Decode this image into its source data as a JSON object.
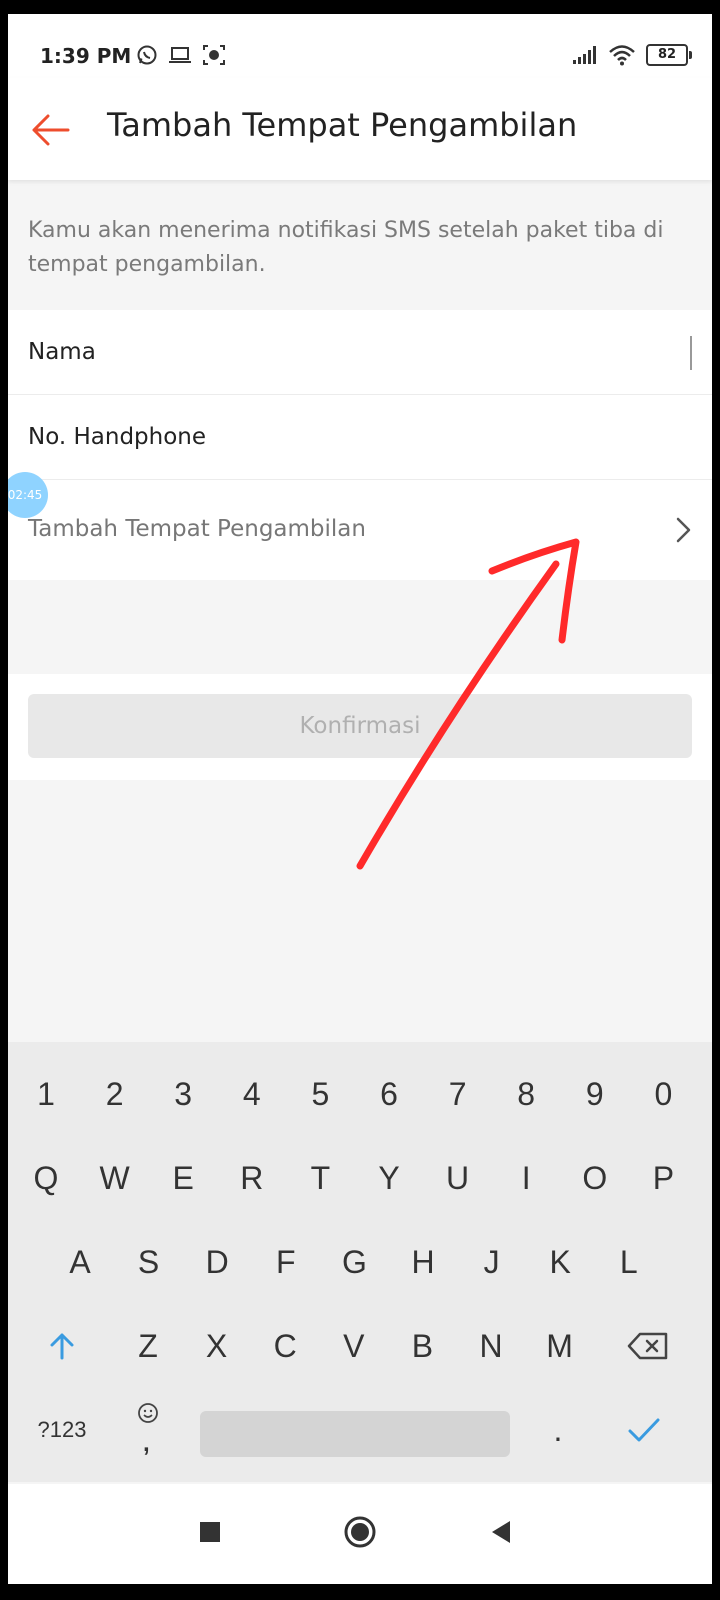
{
  "status_bar": {
    "time": "1:39 PM",
    "battery": "82",
    "icons_left": [
      "whatsapp-icon",
      "laptop-icon",
      "screen-record-icon"
    ],
    "icons_right": [
      "signal-icon",
      "wifi-icon",
      "battery-icon"
    ]
  },
  "header": {
    "title": "Tambah Tempat Pengambilan",
    "back_icon": "arrow-left-icon",
    "accent_color": "#ee4d2d"
  },
  "notice": "Kamu akan menerima notifikasi SMS setelah paket tiba di tempat pengambilan.",
  "form": {
    "name_label": "Nama",
    "phone_label": "No. Handphone",
    "pickup_label": "Tambah Tempat Pengambilan"
  },
  "floating_bubble": "02:45",
  "confirm_label": "Konfirmasi",
  "keyboard": {
    "numbers": [
      "1",
      "2",
      "3",
      "4",
      "5",
      "6",
      "7",
      "8",
      "9",
      "0"
    ],
    "row1": [
      "Q",
      "W",
      "E",
      "R",
      "T",
      "Y",
      "U",
      "I",
      "O",
      "P"
    ],
    "row2": [
      "A",
      "S",
      "D",
      "F",
      "G",
      "H",
      "J",
      "K",
      "L"
    ],
    "row3": [
      "Z",
      "X",
      "C",
      "V",
      "B",
      "N",
      "M"
    ],
    "symbols_label": "?123",
    "comma": ",",
    "period": ".",
    "shift_icon": "shift-arrow-up-icon",
    "backspace_icon": "backspace-icon",
    "enter_icon": "checkmark-icon",
    "emoji_icon": "emoji-icon"
  },
  "nav": [
    "square-recent-icon",
    "circle-home-icon",
    "triangle-back-icon"
  ],
  "annotation_color": "#ff2a2a"
}
